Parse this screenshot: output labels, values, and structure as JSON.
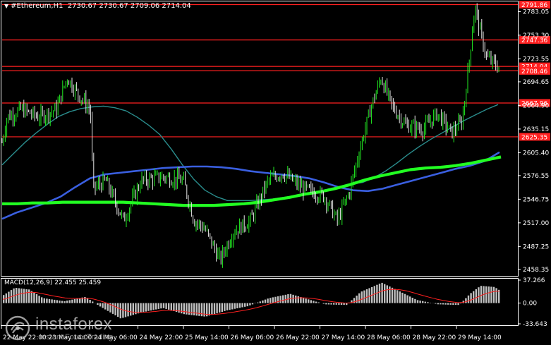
{
  "header": {
    "symbol": "#Ethereum,H1",
    "ohlc": "2730.67 2730.67 2709.06 2714.04"
  },
  "indicator": {
    "macd_label": "MACD(12,26,9) 22.455 25.459"
  },
  "watermark": {
    "name": "instaforex",
    "tagline": "Instant Forex Trading"
  },
  "colors": {
    "background": "#000000",
    "level_line": "#ff2020",
    "ma_fast": "#2a8d8d",
    "ma_mid": "#3a5fe0",
    "ma_slow": "#22ff22",
    "macd_hist": "#c0c0c0",
    "macd_signal": "#ff2020",
    "bull": "#22ee22",
    "bear": "#e8e8e8"
  },
  "chart_data": {
    "type": "candlestick",
    "price_axis": {
      "ticks": [
        "2783.05",
        "2753.30",
        "2723.55",
        "2694.65",
        "2664.90",
        "2635.15",
        "2605.40",
        "2576.55",
        "2546.75",
        "2517.00",
        "2487.25",
        "2458.35"
      ],
      "ylim": [
        2452,
        2795
      ]
    },
    "time_axis": {
      "ticks": [
        "22 May 22:00",
        "23 May 14:00",
        "24 May 06:00",
        "24 May 22:00",
        "25 May 14:00",
        "26 May 06:00",
        "26 May 22:00",
        "27 May 14:00",
        "28 May 06:00",
        "28 May 22:00",
        "29 May 14:00"
      ]
    },
    "levels": [
      {
        "label": "2791.86",
        "value": 2791.86
      },
      {
        "label": "2747.36",
        "value": 2747.36
      },
      {
        "label": "2714.04",
        "value": 2714.04
      },
      {
        "label": "2708.46",
        "value": 2708.46
      },
      {
        "label": "2667.96",
        "value": 2667.96
      },
      {
        "label": "2625.35",
        "value": 2625.35
      }
    ],
    "series": [
      {
        "name": "ma_fast",
        "values": [
          2590,
          2604,
          2618,
          2630,
          2641,
          2651,
          2657,
          2661,
          2663,
          2664,
          2662,
          2658,
          2650,
          2640,
          2628,
          2610,
          2590,
          2572,
          2558,
          2550,
          2545,
          2545,
          2545,
          2546,
          2547,
          2549,
          2551,
          2553,
          2556,
          2560,
          2563,
          2566,
          2568,
          2574,
          2582,
          2592,
          2603,
          2613,
          2622,
          2630,
          2638,
          2646,
          2653,
          2660,
          2666
        ]
      },
      {
        "name": "ma_mid",
        "values": [
          2522,
          2530,
          2536,
          2542,
          2550,
          2562,
          2573,
          2578,
          2580,
          2582,
          2584,
          2586,
          2587,
          2588,
          2588,
          2587,
          2585,
          2582,
          2580,
          2578,
          2576,
          2573,
          2568,
          2562,
          2558,
          2557,
          2560,
          2565,
          2570,
          2575,
          2580,
          2585,
          2589,
          2595,
          2606
        ]
      },
      {
        "name": "ma_slow",
        "values": [
          2541,
          2541,
          2542,
          2542,
          2543,
          2543,
          2543,
          2543,
          2543,
          2542,
          2541,
          2540,
          2539,
          2539,
          2539,
          2540,
          2541,
          2543,
          2546,
          2549,
          2553,
          2556,
          2560,
          2565,
          2571,
          2576,
          2580,
          2584,
          2586,
          2587,
          2589,
          2592,
          2596,
          2600
        ]
      },
      {
        "name": "macd",
        "ylim": [
          -33.643,
          37.266
        ],
        "ticks": [
          "37.266",
          "0.00",
          "-33.643"
        ]
      }
    ]
  }
}
